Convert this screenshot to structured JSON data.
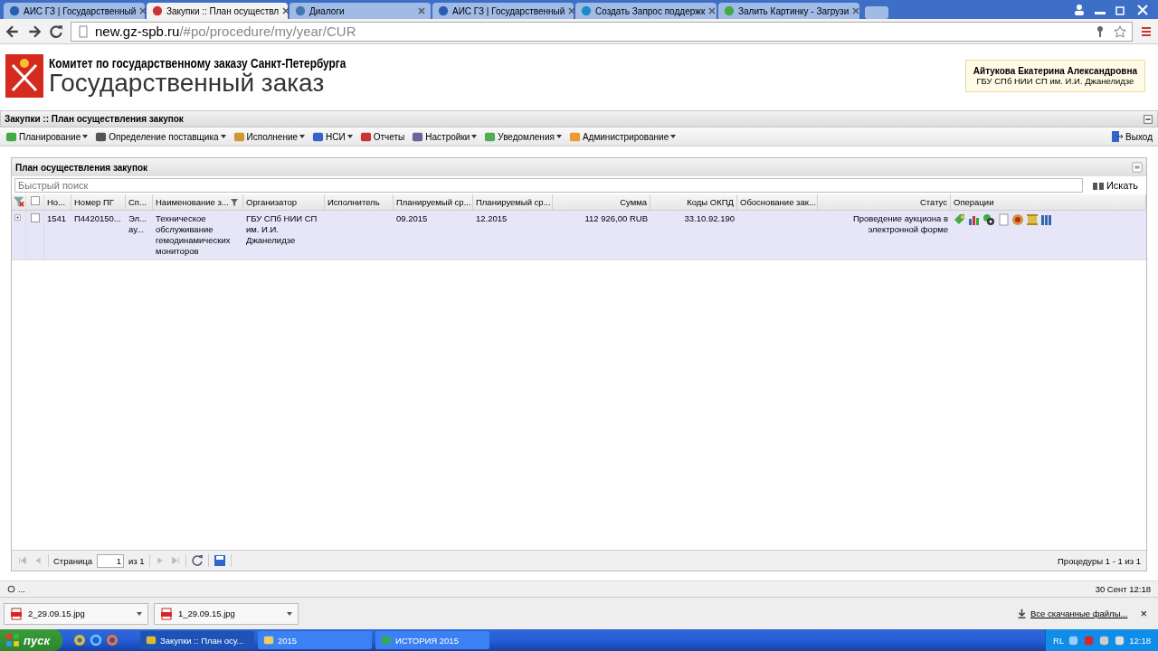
{
  "browser": {
    "tabs": [
      {
        "title": "АИС ГЗ | Государственный",
        "selected": false
      },
      {
        "title": "Закупки :: План осуществл",
        "selected": true
      },
      {
        "title": "Диалоги",
        "selected": false
      },
      {
        "title": "АИС ГЗ | Государственный",
        "selected": false
      },
      {
        "title": "Создать Запрос поддержк",
        "selected": false
      },
      {
        "title": "Залить Картинку - Загрузи",
        "selected": false
      }
    ],
    "address": {
      "host": "new.gz-spb.ru",
      "path": "/#po/procedure/my/year/CUR"
    }
  },
  "header": {
    "org_line": "Комитет по государственному заказу Санкт-Петербурга",
    "title": "Государственный заказ",
    "user": {
      "name": "Айтукова Екатерина Александровна",
      "org": "ГБУ СПб НИИ СП им. И.И. Джанелидзе"
    }
  },
  "page_title": "Закупки :: План осуществления закупок",
  "menu": [
    {
      "label": "Планирование",
      "dropdown": true
    },
    {
      "label": "Определение поставщика",
      "dropdown": true
    },
    {
      "label": "Исполнение",
      "dropdown": true
    },
    {
      "label": "НСИ",
      "dropdown": true
    },
    {
      "label": "Отчеты",
      "dropdown": false
    },
    {
      "label": "Настройки",
      "dropdown": true
    },
    {
      "label": "Уведомления",
      "dropdown": true
    },
    {
      "label": "Администрирование",
      "dropdown": true
    }
  ],
  "exit": "Выход",
  "panel": {
    "title": "План осуществления закупок",
    "search": {
      "placeholder": "Быстрый поиск",
      "button": "Искать"
    },
    "table": {
      "select_all_checked": false,
      "columns": [
        {
          "label": "Но..."
        },
        {
          "label": "Номер ПГ"
        },
        {
          "label": "Сп..."
        },
        {
          "label": "Наименование з..."
        },
        {
          "label": "Организатор"
        },
        {
          "label": "Исполнитель"
        },
        {
          "label": "Планируемый ср..."
        },
        {
          "label": "Планируемый ср..."
        },
        {
          "label": "Сумма"
        },
        {
          "label": "Коды ОКПД"
        },
        {
          "label": "Обоснование зак..."
        },
        {
          "label": "Статус"
        },
        {
          "label": "Операции"
        }
      ],
      "rows": [
        {
          "selected": true,
          "checked": false,
          "cells": [
            "1541",
            "П4420150...",
            "Эл... ау...",
            "Техническое обслуживание гемодинамических мониторов",
            "ГБУ СПб НИИ СП им. И.И. Джанелидзе",
            "",
            "09.2015",
            "12.2015",
            "112 926,00 RUB",
            "33.10.92.190",
            "",
            "Проведение аукциона в электронной форме"
          ]
        }
      ]
    },
    "paging": {
      "page_label": "Страница",
      "page": "1",
      "of": "из 1",
      "summary": "Процедуры 1 - 1 из 1"
    }
  },
  "status_bar": {
    "left": "...",
    "right": "30 Сент 12:18"
  },
  "downloads": {
    "files": [
      "2_29.09.15.jpg",
      "1_29.09.15.jpg"
    ],
    "all": "Все скачанные файлы...",
    "close": "×"
  },
  "taskbar": {
    "start": "пуск",
    "tasks": [
      {
        "label": "Закупки :: План осу...",
        "selected": true
      },
      {
        "label": "2015",
        "selected": false
      },
      {
        "label": "ИСТОРИЯ 2015",
        "selected": false
      }
    ],
    "lang": "RL",
    "clock": "12:18"
  }
}
